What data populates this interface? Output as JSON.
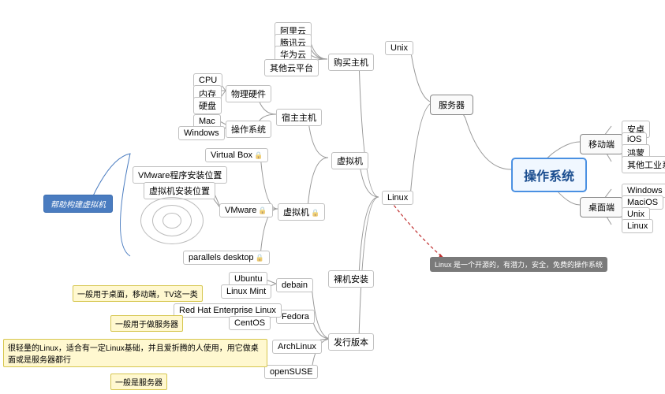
{
  "root": "操作系统",
  "server": "服务器",
  "mobile": "移动端",
  "desktop": "桌面端",
  "unix": "Unix",
  "linux": "Linux",
  "buy": "购买主机",
  "vm": "虚拟机",
  "bare": "裸机安装",
  "dist": "发行版本",
  "aliyun": "阿里云",
  "tencent": "腾讯云",
  "huawei": "华为云",
  "othercloud": "其他云平台",
  "host": "宿主主机",
  "os": "操作系统",
  "hw": "物理硬件",
  "cpu": "CPU",
  "mem": "内存",
  "disk": "硬盘",
  "mac": "Mac",
  "win": "Windows",
  "vbox": "Virtual Box",
  "vmware": "VMware",
  "pd": "parallels desktop",
  "vm2": "虚拟机",
  "vminst": "VMware程序安装位置",
  "vmloc": "虚拟机安装位置",
  "debian": "debain",
  "fedora": "Fedora",
  "arch": "ArchLinux",
  "suse": "openSUSE",
  "ubuntu": "Ubuntu",
  "mint": "Linux Mint",
  "rhel": "Red Hat Enterprise Linux",
  "centos": "CentOS",
  "android": "安卓",
  "ios": "iOS",
  "harmony": "鸿蒙",
  "otherind": "其他工业系统",
  "dwin": "Windows",
  "dmac": "MaciOS",
  "dunix": "Unix",
  "dlinux": "Linux",
  "callout": "帮助构建虚拟机",
  "annot": "Linux 是一个开源的，有潜力，安全，免费的操作系统",
  "note_deb": "一般用于桌面，移动端，TV这一类",
  "note_fed": "一般用于做服务器",
  "note_arch": "很轻量的Linux，适合有一定Linux基础，并且爱折腾的人使用，用它做桌面或是服务器都行",
  "note_suse": "一般是服务器"
}
